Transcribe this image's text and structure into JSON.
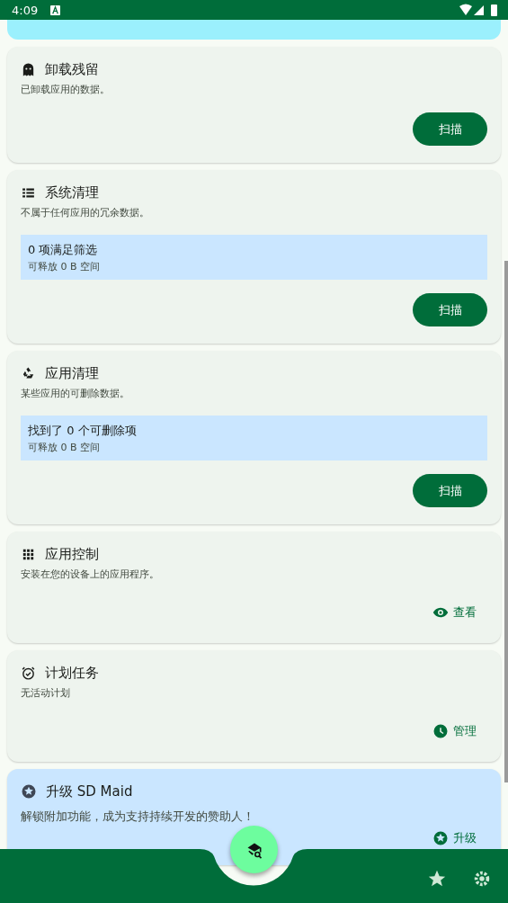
{
  "status_bar": {
    "time": "4:09"
  },
  "cards": [
    {
      "title": "卸载残留",
      "subtitle": "已卸载应用的数据。",
      "action": {
        "kind": "filled",
        "label": "扫描"
      }
    },
    {
      "title": "系统清理",
      "subtitle": "不属于任何应用的冗余数据。",
      "info": {
        "headline": "0 项满足筛选",
        "detail": "可释放 0 B 空间"
      },
      "action": {
        "kind": "filled",
        "label": "扫描"
      }
    },
    {
      "title": "应用清理",
      "subtitle": "某些应用的可删除数据。",
      "info": {
        "headline": "找到了 0 个可删除项",
        "detail": "可释放 0 B 空间"
      },
      "action": {
        "kind": "filled",
        "label": "扫描"
      }
    },
    {
      "title": "应用控制",
      "subtitle": "安装在您的设备上的应用程序。",
      "action": {
        "kind": "text",
        "label": "查看"
      }
    },
    {
      "title": "计划任务",
      "subtitle": "无活动计划",
      "action": {
        "kind": "text",
        "label": "管理"
      }
    }
  ],
  "upgrade": {
    "title": "升级 SD Maid",
    "subtitle": "解锁附加功能，成为支持持续开发的赞助人！",
    "action": {
      "kind": "text",
      "label": "升级"
    }
  }
}
